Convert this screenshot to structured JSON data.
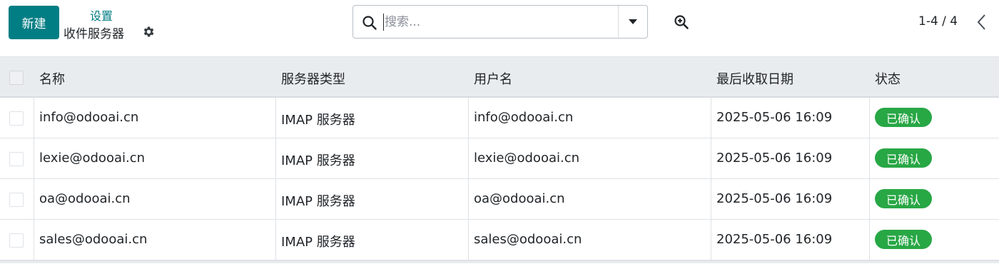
{
  "control_panel": {
    "new_button_label": "新建",
    "breadcrumb": {
      "parent": "设置",
      "current": "收件服务器"
    },
    "gear_icon": "gear-icon",
    "search": {
      "placeholder": "搜索...",
      "value": ""
    },
    "pager": {
      "text": "1-4 / 4"
    }
  },
  "table": {
    "columns": [
      "名称",
      "服务器类型",
      "用户名",
      "最后收取日期",
      "状态"
    ],
    "rows": [
      {
        "name": "info@odooai.cn",
        "server_type": "IMAP 服务器",
        "username": "info@odooai.cn",
        "last_fetch": "2025-05-06 16:09",
        "state": "已确认"
      },
      {
        "name": "lexie@odooai.cn",
        "server_type": "IMAP 服务器",
        "username": "lexie@odooai.cn",
        "last_fetch": "2025-05-06 16:09",
        "state": "已确认"
      },
      {
        "name": "oa@odooai.cn",
        "server_type": "IMAP 服务器",
        "username": "oa@odooai.cn",
        "last_fetch": "2025-05-06 16:09",
        "state": "已确认"
      },
      {
        "name": "sales@odooai.cn",
        "server_type": "IMAP 服务器",
        "username": "sales@odooai.cn",
        "last_fetch": "2025-05-06 16:09",
        "state": "已确认"
      }
    ]
  },
  "colors": {
    "primary": "#017e84",
    "success_badge": "#28a745",
    "header_bg": "#e9ecef"
  }
}
